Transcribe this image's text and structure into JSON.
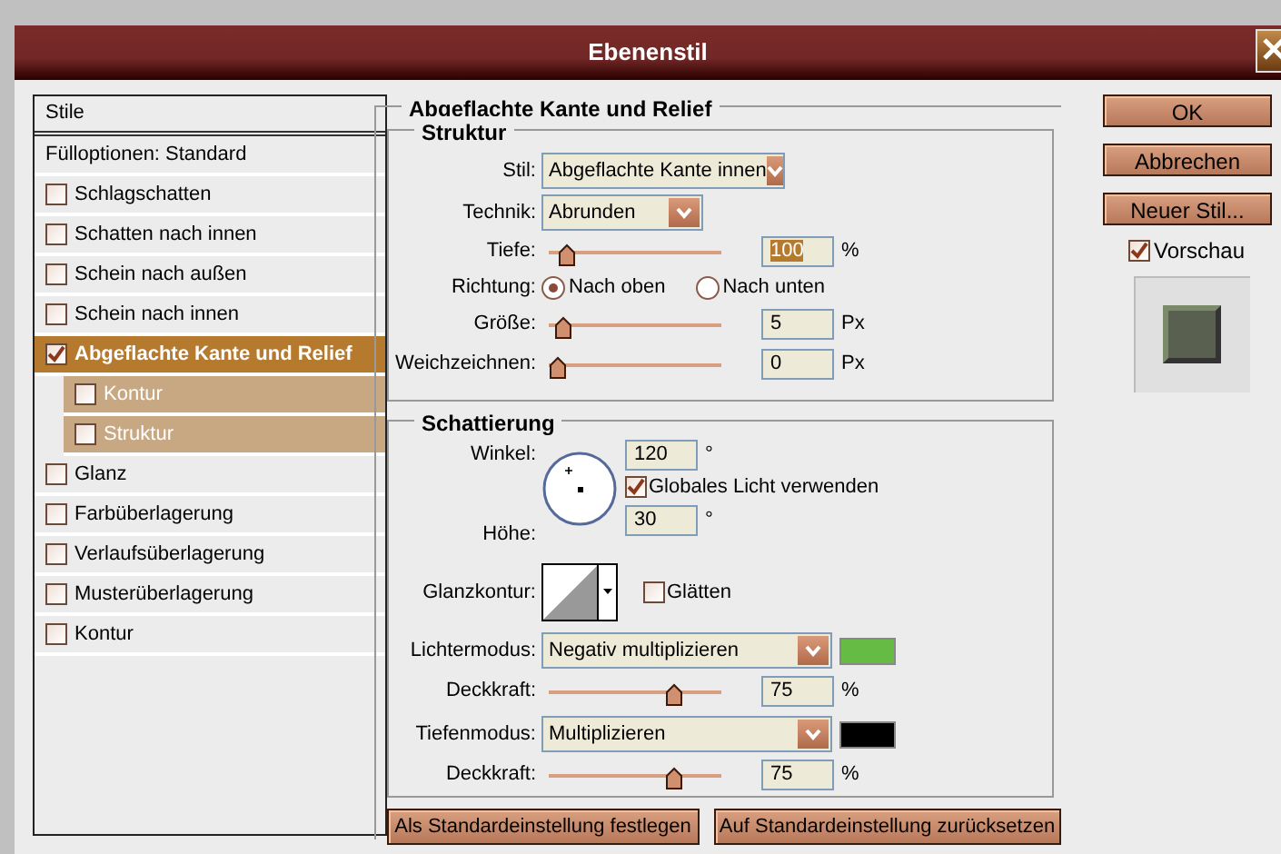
{
  "window": {
    "title": "Ebenenstil"
  },
  "styles_list": {
    "header": "Stile",
    "items": [
      {
        "label": "Fülloptionen: Standard",
        "kind": "plain",
        "selected": false
      },
      {
        "label": "Schlagschatten",
        "kind": "check",
        "checked": false,
        "selected": false
      },
      {
        "label": "Schatten nach innen",
        "kind": "check",
        "checked": false,
        "selected": false
      },
      {
        "label": "Schein nach außen",
        "kind": "check",
        "checked": false,
        "selected": false
      },
      {
        "label": "Schein nach innen",
        "kind": "check",
        "checked": false,
        "selected": false
      },
      {
        "label": "Abgeflachte Kante und Relief",
        "kind": "check",
        "checked": true,
        "selected": true,
        "children": [
          {
            "label": "Kontur",
            "kind": "check",
            "checked": false,
            "selected": false
          },
          {
            "label": "Struktur",
            "kind": "check",
            "checked": false,
            "selected": false
          }
        ]
      },
      {
        "label": "Glanz",
        "kind": "check",
        "checked": false,
        "selected": false
      },
      {
        "label": "Farbüberlagerung",
        "kind": "check",
        "checked": false,
        "selected": false
      },
      {
        "label": "Verlaufsüberlagerung",
        "kind": "check",
        "checked": false,
        "selected": false
      },
      {
        "label": "Musterüberlagerung",
        "kind": "check",
        "checked": false,
        "selected": false
      },
      {
        "label": "Kontur",
        "kind": "check",
        "checked": false,
        "selected": false
      }
    ]
  },
  "panel": {
    "title": "Abgeflachte Kante und Relief",
    "structure": {
      "title": "Struktur",
      "style": {
        "label": "Stil:",
        "value": "Abgeflachte Kante innen"
      },
      "technique": {
        "label": "Technik:",
        "value": "Abrunden"
      },
      "depth": {
        "label": "Tiefe:",
        "level": 0.06,
        "value": "100",
        "highlighted": true,
        "unit": "%"
      },
      "direction": {
        "label": "Richtung:",
        "options": [
          {
            "label": "Nach oben",
            "selected": true
          },
          {
            "label": "Nach unten",
            "selected": false
          }
        ]
      },
      "size": {
        "label": "Größe:",
        "level": 0.03,
        "value": "5",
        "unit": "Px"
      },
      "soften": {
        "label": "Weichzeichnen:",
        "level": 0,
        "value": "0",
        "unit": "Px"
      }
    },
    "shading": {
      "title": "Schattierung",
      "angle": {
        "label": "Winkel:",
        "value": "120",
        "unit": "°"
      },
      "global_light": {
        "label": "Globales Licht verwenden",
        "checked": true
      },
      "altitude": {
        "label": "Höhe:",
        "value": "30",
        "unit": "°"
      },
      "gloss_contour": {
        "label": "Glanzkontur:"
      },
      "anti_aliased": {
        "label": "Glätten",
        "checked": false
      },
      "highlight_mode": {
        "label": "Lichtermodus:",
        "value": "Negativ multiplizieren",
        "color": "#66bb44"
      },
      "highlight_opacity": {
        "label": "Deckkraft:",
        "level": 0.75,
        "value": "75",
        "unit": "%"
      },
      "shadow_mode": {
        "label": "Tiefenmodus:",
        "value": "Multiplizieren",
        "color": "#000000"
      },
      "shadow_opacity": {
        "label": "Deckkraft:",
        "level": 0.75,
        "value": "75",
        "unit": "%"
      }
    },
    "buttons": [
      "Als Standardeinstellung festlegen",
      "Auf Standardeinstellung zurücksetzen"
    ]
  },
  "side": {
    "buttons": [
      "OK",
      "Abbrechen",
      "Neuer Stil..."
    ],
    "preview": {
      "label": "Vorschau",
      "checked": true
    }
  }
}
